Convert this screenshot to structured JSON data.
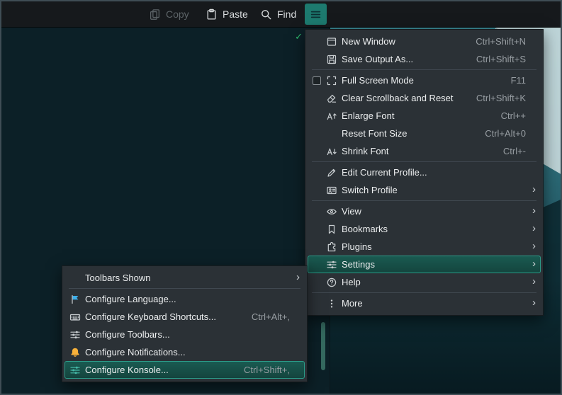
{
  "toolbar": {
    "copy_label": "Copy",
    "paste_label": "Paste",
    "find_label": "Find"
  },
  "terminal": {
    "status_indicator": "✓"
  },
  "colors": {
    "accent_teal": "#1d7a6f",
    "highlight_fill": "#17564d",
    "highlight_border": "#2b9c89",
    "terminal_background": "#0c2027",
    "menu_background": "#2b3136",
    "success_green": "#2fbf71",
    "flag_blue": "#3daee9",
    "bell_yellow": "#f9b13a"
  },
  "main_menu": {
    "items": [
      {
        "type": "item",
        "icon": "new-window",
        "label": "New Window",
        "shortcut": "Ctrl+Shift+N"
      },
      {
        "type": "item",
        "icon": "save",
        "label": "Save Output As...",
        "shortcut": "Ctrl+Shift+S"
      },
      {
        "type": "separator"
      },
      {
        "type": "item",
        "checkbox": true,
        "checked": false,
        "icon": "fullscreen",
        "label": "Full Screen Mode",
        "shortcut": "F11"
      },
      {
        "type": "item",
        "icon": "clear-history",
        "label": "Clear Scrollback and Reset",
        "shortcut": "Ctrl+Shift+K"
      },
      {
        "type": "item",
        "icon": "font-up",
        "label": "Enlarge Font",
        "shortcut": "Ctrl++"
      },
      {
        "type": "item",
        "label": "Reset Font Size",
        "shortcut": "Ctrl+Alt+0"
      },
      {
        "type": "item",
        "icon": "font-down",
        "label": "Shrink Font",
        "shortcut": "Ctrl+-"
      },
      {
        "type": "separator"
      },
      {
        "type": "item",
        "icon": "edit-profile",
        "label": "Edit Current Profile..."
      },
      {
        "type": "item",
        "icon": "switch-profile",
        "label": "Switch Profile",
        "submenu": true
      },
      {
        "type": "separator"
      },
      {
        "type": "item",
        "icon": "view",
        "label": "View",
        "submenu": true
      },
      {
        "type": "item",
        "icon": "bookmarks",
        "label": "Bookmarks",
        "submenu": true
      },
      {
        "type": "item",
        "icon": "plugins",
        "label": "Plugins",
        "submenu": true
      },
      {
        "type": "item",
        "icon": "settings",
        "label": "Settings",
        "submenu": true,
        "highlighted": true
      },
      {
        "type": "item",
        "icon": "help",
        "label": "Help",
        "submenu": true
      },
      {
        "type": "separator"
      },
      {
        "type": "item",
        "icon": "more",
        "label": "More",
        "submenu": true
      }
    ]
  },
  "settings_submenu": {
    "items": [
      {
        "type": "item",
        "label": "Toolbars Shown",
        "submenu": true
      },
      {
        "type": "separator"
      },
      {
        "type": "item",
        "icon": "language",
        "label": "Configure Language..."
      },
      {
        "type": "item",
        "icon": "keyboard",
        "label": "Configure Keyboard Shortcuts...",
        "shortcut": "Ctrl+Alt+,"
      },
      {
        "type": "item",
        "icon": "toolbars",
        "label": "Configure Toolbars..."
      },
      {
        "type": "item",
        "icon": "notifications",
        "label": "Configure Notifications..."
      },
      {
        "type": "item",
        "icon": "configure-konsole",
        "label": "Configure Konsole...",
        "shortcut": "Ctrl+Shift+,",
        "highlighted": true
      }
    ]
  }
}
